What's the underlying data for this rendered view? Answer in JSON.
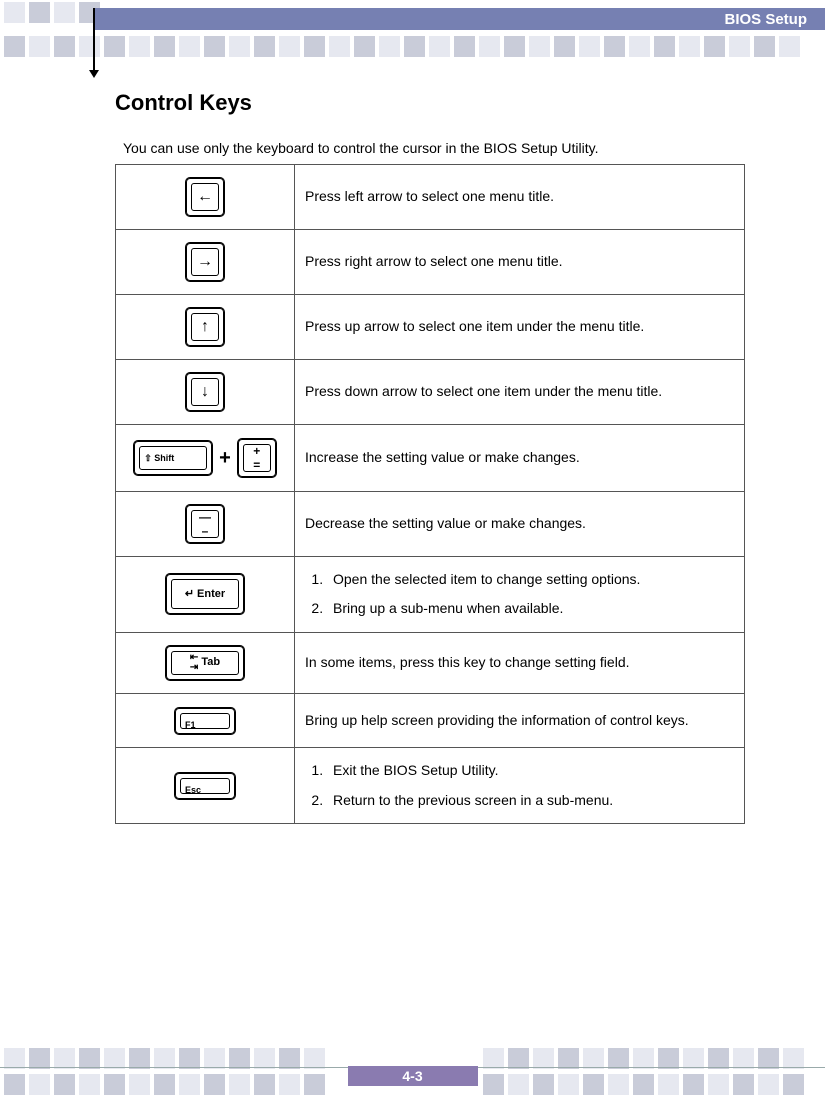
{
  "header": {
    "title": "BIOS Setup"
  },
  "section_title": "Control Keys",
  "intro": "You can use only the keyboard to control the cursor in the BIOS Setup Utility.",
  "rows": {
    "left": {
      "glyph": "←",
      "desc": "Press left arrow to select one menu title."
    },
    "right": {
      "glyph": "→",
      "desc": "Press right arrow to select one menu title."
    },
    "up": {
      "glyph": "↑",
      "desc": "Press up arrow to select one item under the menu title."
    },
    "down": {
      "glyph": "↓",
      "desc": "Press down arrow to select one item under the menu title."
    },
    "inc": {
      "shift": "⇧ Shift",
      "plus_top": "+",
      "plus_bot": "=",
      "desc": "Increase the setting value or make changes."
    },
    "dec": {
      "top": "—",
      "bot": "–",
      "desc": "Decrease the setting value or make changes."
    },
    "enter": {
      "label": "Enter",
      "item1": "Open the selected item to change setting options.",
      "item2": "Bring up a sub-menu when available."
    },
    "tab": {
      "label": "Tab",
      "desc": "In some items, press this key to change setting field."
    },
    "f1": {
      "label": "F1",
      "desc": "Bring up help screen providing the information of control keys."
    },
    "esc": {
      "label": "Esc",
      "item1": "Exit the BIOS Setup Utility.",
      "item2": "Return to the previous screen in a sub-menu."
    }
  },
  "page_number": "4-3"
}
